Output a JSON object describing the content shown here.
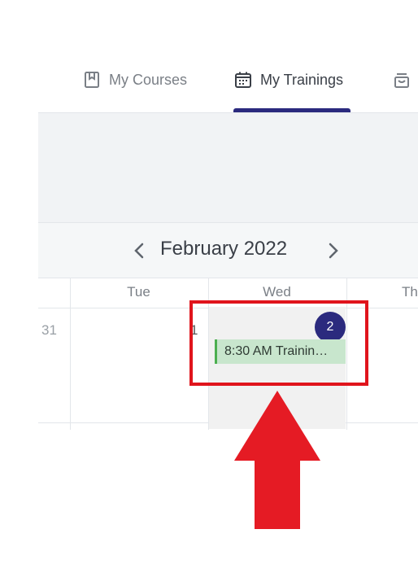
{
  "tabs": {
    "items": [
      {
        "label": "My Courses",
        "icon": "book-icon"
      },
      {
        "label": "My Trainings",
        "icon": "calendar-icon",
        "active": true
      },
      {
        "label": "",
        "icon": "inbox-icon"
      }
    ]
  },
  "calendar": {
    "month_title": "February 2022",
    "weekdays": [
      "Tue",
      "Wed",
      "Th"
    ],
    "days": {
      "prev": "31",
      "wed": "1"
    },
    "event_count_badge": "2",
    "event": {
      "label": "8:30 AM Trainin…"
    }
  },
  "colors": {
    "accent": "#2b2a7e",
    "event_bg": "#c8e6cd",
    "event_border": "#4caf50",
    "highlight": "#e0141c"
  }
}
